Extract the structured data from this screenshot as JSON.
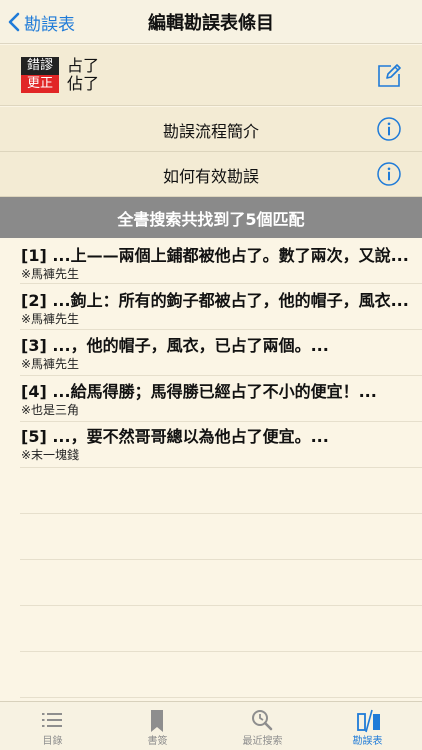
{
  "nav": {
    "back_label": "勘誤表",
    "title": "編輯勘誤表條目"
  },
  "entry": {
    "badge_top": "錯謬",
    "badge_bottom": "更正",
    "wrong_word": "占了",
    "correct_word": "佔了"
  },
  "info_rows": [
    {
      "label": "勘誤流程簡介"
    },
    {
      "label": "如何有效勘誤"
    }
  ],
  "banner": "全書搜索共找到了5個匹配",
  "results": [
    {
      "text": "[1] ...上——兩個上鋪都被他占了。數了兩次，又說...",
      "source": "※馬褲先生"
    },
    {
      "text": "[2] ...鉤上：所有的鉤子都被占了，他的帽子，風衣...",
      "source": "※馬褲先生"
    },
    {
      "text": "[3] ...，他的帽子，風衣，已占了兩個。...",
      "source": "※馬褲先生"
    },
    {
      "text": "[4] ...給馬得勝；馬得勝已經占了不小的便宜！...",
      "source": "※也是三角"
    },
    {
      "text": "[5] ...，要不然哥哥總以為他占了便宜。...",
      "source": "※末一塊錢"
    }
  ],
  "tabs": [
    {
      "label": "目錄",
      "icon": "list-icon"
    },
    {
      "label": "書簽",
      "icon": "bookmark-icon"
    },
    {
      "label": "最近搜索",
      "icon": "history-search-icon"
    },
    {
      "label": "勘誤表",
      "icon": "errata-icon"
    }
  ],
  "colors": {
    "accent": "#1f7bd8",
    "background": "#fbf5e5",
    "banner": "#8a8a8a",
    "badge_red": "#e12626"
  }
}
